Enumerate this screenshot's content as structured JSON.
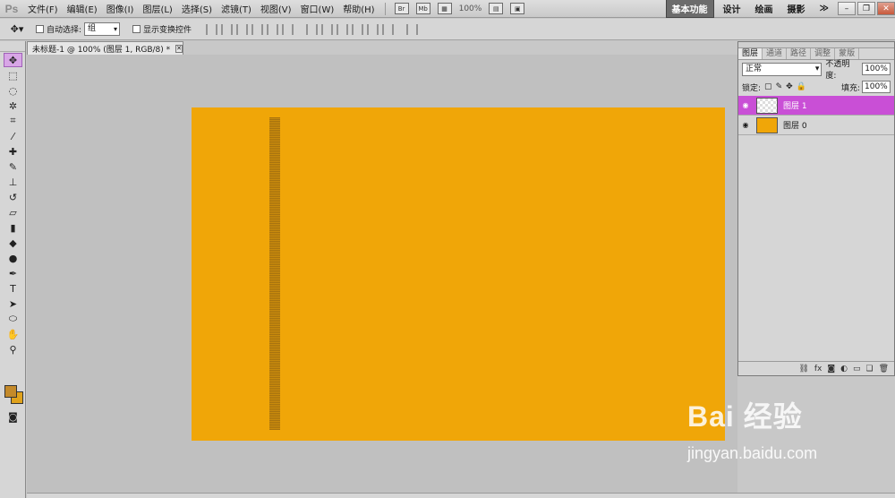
{
  "menubar": {
    "logo": "Ps",
    "items": [
      "文件(F)",
      "编辑(E)",
      "图像(I)",
      "图层(L)",
      "选择(S)",
      "滤镜(T)",
      "视图(V)",
      "窗口(W)",
      "帮助(H)"
    ],
    "zoom": "100%",
    "workspaces": [
      "基本功能",
      "设计",
      "绘画",
      "摄影"
    ],
    "more": "≫"
  },
  "optionsbar": {
    "auto_select_label": "自动选择:",
    "auto_select_value": "组",
    "show_transform_label": "显示变换控件"
  },
  "document": {
    "tab_title": "未标题-1 @ 100% (图层 1, RGB/8) *"
  },
  "layers_panel": {
    "tabs": [
      "图层",
      "通道",
      "路径",
      "调整",
      "蒙版"
    ],
    "blend_mode": "正常",
    "opacity_label": "不透明度:",
    "opacity_value": "100%",
    "lock_label": "锁定:",
    "fill_label": "填充:",
    "fill_value": "100%",
    "layers": [
      {
        "name": "图层 1",
        "selected": true
      },
      {
        "name": "图层 0",
        "selected": false
      }
    ]
  },
  "watermark": {
    "brand": "Bai 经验",
    "url": "jingyan.baidu.com"
  },
  "colors": {
    "canvas": "#f0a608",
    "selection": "#c94fd6",
    "foreground": "#c48a2a",
    "background": "#e0a21c"
  }
}
